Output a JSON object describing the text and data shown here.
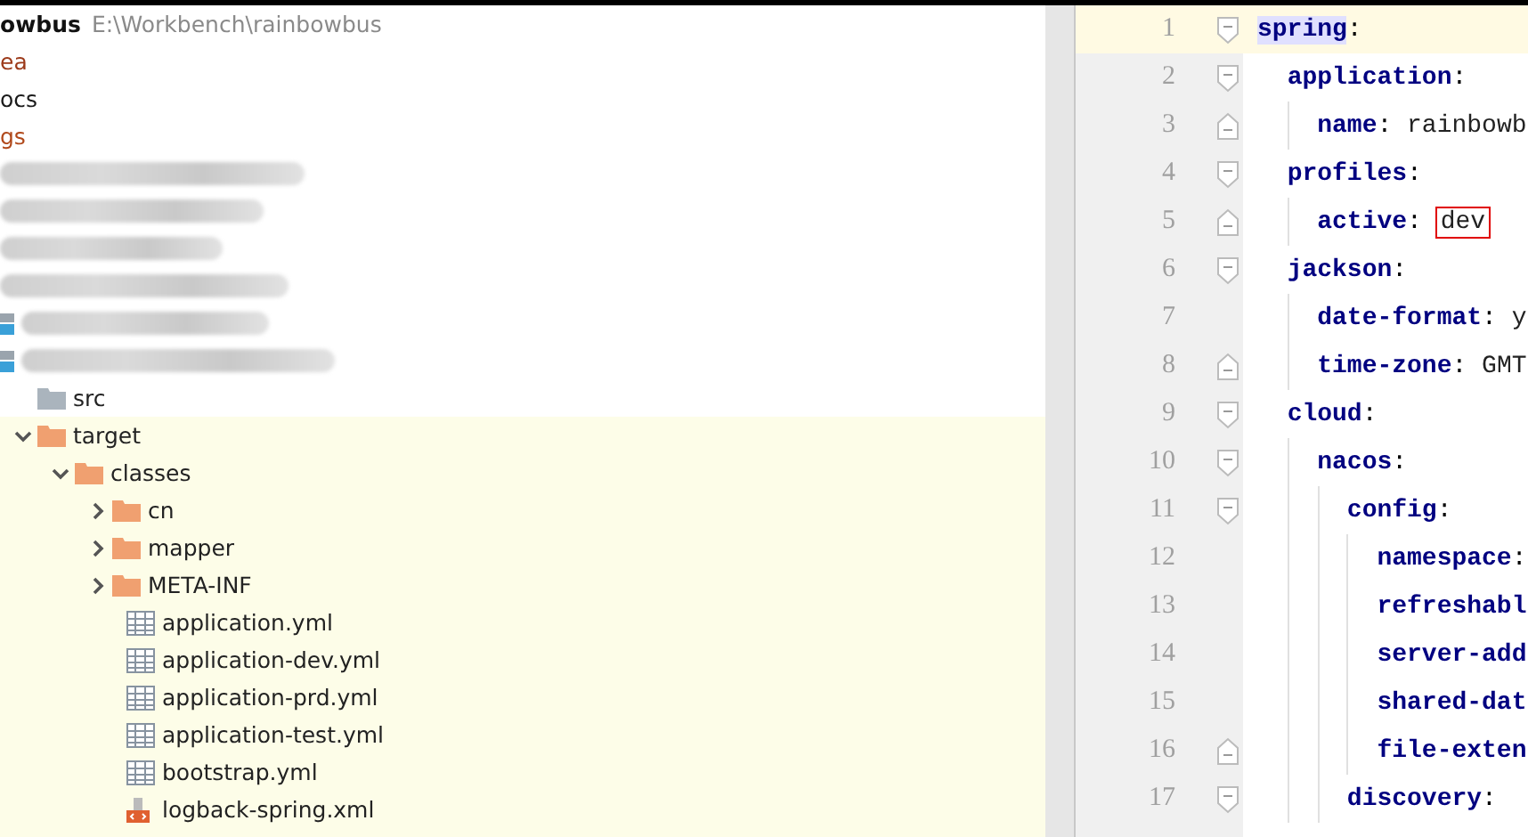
{
  "project_tree": {
    "header": {
      "name": "owbus",
      "path": "E:\\Workbench\\rainbowbus"
    },
    "items": [
      {
        "kind": "folder_plain",
        "name": "ea",
        "color": "#9c3a1a"
      },
      {
        "kind": "folder_plain",
        "name": "ocs",
        "color": "#1a1a1a"
      },
      {
        "kind": "folder_plain",
        "name": "gs",
        "color": "#b0481a"
      },
      {
        "kind": "redacted"
      },
      {
        "kind": "redacted"
      },
      {
        "kind": "redacted"
      },
      {
        "kind": "redacted"
      },
      {
        "kind": "redacted_module"
      },
      {
        "kind": "redacted_module",
        "children": [
          {
            "kind": "folder",
            "name": "src",
            "excluded": false
          },
          {
            "kind": "folder",
            "name": "target",
            "excluded": true,
            "expanded": true,
            "children": [
              {
                "kind": "folder",
                "name": "classes",
                "excluded": true,
                "expanded": true,
                "children": [
                  {
                    "kind": "folder",
                    "name": "cn",
                    "excluded": true,
                    "expanded": false
                  },
                  {
                    "kind": "folder",
                    "name": "mapper",
                    "excluded": true,
                    "expanded": false
                  },
                  {
                    "kind": "folder",
                    "name": "META-INF",
                    "excluded": true,
                    "expanded": false
                  },
                  {
                    "kind": "yml",
                    "name": "application.yml"
                  },
                  {
                    "kind": "yml",
                    "name": "application-dev.yml"
                  },
                  {
                    "kind": "yml",
                    "name": "application-prd.yml"
                  },
                  {
                    "kind": "yml",
                    "name": "application-test.yml"
                  },
                  {
                    "kind": "yml",
                    "name": "bootstrap.yml"
                  },
                  {
                    "kind": "xml",
                    "name": "logback-spring.xml"
                  }
                ]
              }
            ]
          }
        ]
      }
    ]
  },
  "editor": {
    "lines": [
      {
        "number": "1",
        "kind": "fold_start",
        "key": "spring",
        "punct": ":",
        "current": true,
        "selected": true
      },
      {
        "number": "2",
        "kind": "fold_start",
        "key": "  application",
        "punct": ":",
        "current": false,
        "selected": false
      },
      {
        "number": "3",
        "kind": "fold_end",
        "key": "    name",
        "punct": ":",
        "value": "rainbowb",
        "current": false,
        "selected": false
      },
      {
        "number": "4",
        "kind": "fold_start",
        "key": "  profiles",
        "punct": ":",
        "current": false,
        "selected": false
      },
      {
        "number": "5",
        "kind": "fold_end",
        "key": "    active",
        "punct": ":",
        "value": "dev",
        "boxed": true,
        "current": false,
        "selected": false
      },
      {
        "number": "6",
        "kind": "fold_start",
        "key": "  jackson",
        "punct": ":",
        "current": false,
        "selected": false
      },
      {
        "number": "7",
        "kind": "plain",
        "key": "    date-format",
        "punct": ":",
        "value": "y",
        "current": false,
        "selected": false
      },
      {
        "number": "8",
        "kind": "fold_end",
        "key": "    time-zone",
        "punct": ":",
        "value": "GMT",
        "current": false,
        "selected": false
      },
      {
        "number": "9",
        "kind": "fold_start",
        "key": "  cloud",
        "punct": ":",
        "current": false,
        "selected": false
      },
      {
        "number": "10",
        "kind": "fold_start",
        "key": "    nacos",
        "punct": ":",
        "current": false,
        "selected": false
      },
      {
        "number": "11",
        "kind": "fold_start",
        "key": "      config",
        "punct": ":",
        "current": false,
        "selected": false
      },
      {
        "number": "12",
        "kind": "plain",
        "key": "        namespace",
        "punct": ":",
        "current": false,
        "selected": false
      },
      {
        "number": "13",
        "kind": "plain",
        "key": "        refreshabl",
        "current": false,
        "selected": false
      },
      {
        "number": "14",
        "kind": "plain",
        "key": "        server-add",
        "current": false,
        "selected": false
      },
      {
        "number": "15",
        "kind": "plain",
        "key": "        shared-dat",
        "current": false,
        "selected": false
      },
      {
        "number": "16",
        "kind": "fold_end",
        "key": "        file-exten",
        "current": false,
        "selected": false
      },
      {
        "number": "17",
        "kind": "fold_start",
        "key": "      discovery",
        "punct": ":",
        "current": false,
        "selected": false
      }
    ]
  }
}
